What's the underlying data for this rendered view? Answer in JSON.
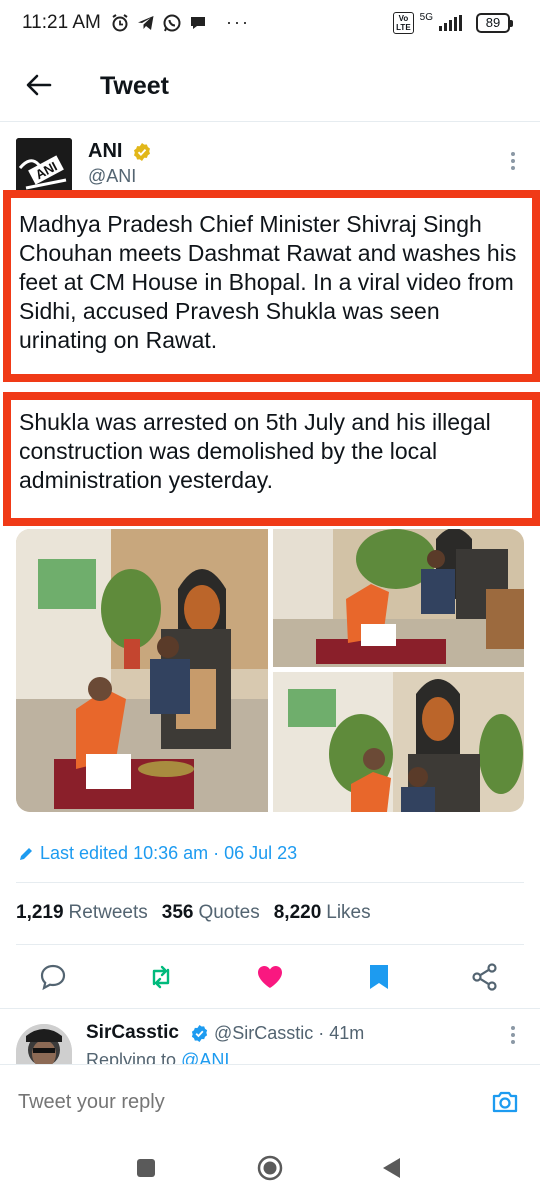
{
  "status_bar": {
    "time": "11:21 AM",
    "volte": "Vo LTE",
    "network": "5G",
    "battery": "89"
  },
  "header": {
    "title": "Tweet"
  },
  "tweet": {
    "author_name": "ANI",
    "author_handle": "@ANI",
    "avatar_text": "ANI",
    "paragraph_1": "Madhya Pradesh Chief Minister Shivraj Singh Chouhan meets Dashmat Rawat and washes his feet at CM House in Bhopal. In a viral video from Sidhi, accused Pravesh Shukla was seen urinating on Rawat.",
    "paragraph_2": "Shukla was arrested on 5th July and his illegal construction was demolished by the local administration yesterday.",
    "edited": "Last edited 10:36 am · 06 Jul 23",
    "stats": {
      "retweets_count": "1,219",
      "retweets_label": "Retweets",
      "quotes_count": "356",
      "quotes_label": "Quotes",
      "likes_count": "8,220",
      "likes_label": "Likes"
    }
  },
  "reply": {
    "name": "SirCasstic",
    "meta": "@SirCasstic · 41m",
    "replying_prefix": "Replying to ",
    "replying_to": "@ANI"
  },
  "compose": {
    "placeholder": "Tweet your reply"
  },
  "colors": {
    "highlight_border": "#f03a17",
    "link_blue": "#1d9bf0",
    "retweet_green": "#00ba7c",
    "like_pink": "#f91880",
    "verified_gold": "#e2b719"
  }
}
